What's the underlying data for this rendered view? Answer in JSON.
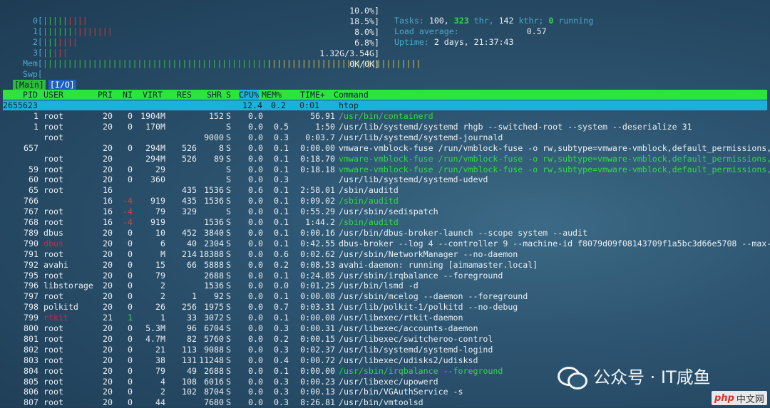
{
  "meters": {
    "cpus": [
      {
        "label": "0[",
        "bar_green": "|||||",
        "bar_red": "||||",
        "value": "10.0%]"
      },
      {
        "label": "1[",
        "bar_green": "||||||",
        "bar_red": "||||||||",
        "value": "18.5%]"
      },
      {
        "label": "2[",
        "bar_green": "|||",
        "bar_red": "||||",
        "value": "8.0%]"
      },
      {
        "label": "3[",
        "bar_green": "||",
        "bar_red": "|||",
        "value": "6.8%]"
      }
    ],
    "mem": {
      "label": "Mem[",
      "bar_green": "|||||||||||||||||||||||||||||||||||||||||||||",
      "bar_yellow": "|||||||||||||||||||||||||||||||",
      "value": "1.32G/3.54G]"
    },
    "swp": {
      "label": "Swp[",
      "value": "0K/0K]"
    }
  },
  "info": {
    "tasks_label": "Tasks:",
    "tasks_value": " 100,",
    "thr_value": " 323",
    "thr_label": " thr,",
    "kthr_value": " 142",
    "kthr_label": " kthr;",
    "running_value": " 0",
    "running_label": " running",
    "load_label": "Load average:",
    "load_value": "0.57",
    "uptime_label": "Uptime:",
    "uptime_value": " 2 days, 21:37:43"
  },
  "tabs": {
    "main": "[Main]",
    "io": "[I/O]"
  },
  "columns": {
    "pid": "PID",
    "user": "USER",
    "pri": "PRI",
    "ni": "NI",
    "virt": "VIRT",
    "res": "RES",
    "shr": "SHR",
    "s": "S",
    "cpu": "CPU%",
    "mem": "MEM%",
    "time": "TIME+",
    "command": "Command"
  },
  "selected": {
    "pid": "2655623",
    "cpu": "12.4",
    "mem": "0.2",
    "time": "0:01",
    "command": "htop"
  },
  "rows": [
    {
      "pid": "1",
      "user": "root",
      "pri": "20",
      "ni": "0",
      "virt": "1904M",
      "res": "",
      "shr": "152",
      "s": "S",
      "cpu": "0.0",
      "mem": "",
      "time": "56.91",
      "command": "/usr/bin/containerd",
      "cmd_color": "green"
    },
    {
      "pid": "1",
      "user": "root",
      "pri": "20",
      "ni": "0",
      "virt": "170M",
      "res": "",
      "shr": "",
      "s": "S",
      "cpu": "0.0",
      "mem": "0.5",
      "time": "1:50",
      "command": "/usr/lib/systemd/systemd rhgb --switched-root --system --deserialize 31",
      "cmd_color": "white"
    },
    {
      "pid": "",
      "user": "root",
      "pri": "",
      "ni": "",
      "virt": "",
      "res": "",
      "shr": "9000",
      "s": "S",
      "cpu": "0.0",
      "mem": "0.3",
      "time": "0:03.7",
      "command": "/usr/lib/systemd/systemd-journald",
      "cmd_color": "white"
    },
    {
      "pid": "657",
      "user": "",
      "pri": "20",
      "ni": "0",
      "virt": "294M",
      "res": "526",
      "shr": "8",
      "s": "S",
      "cpu": "0.0",
      "mem": "0.1",
      "time": "0:00.00",
      "command": "vmware-vmblock-fuse /run/vmblock-fuse -o rw,subtype=vmware-vmblock,default_permissions,",
      "cmd_color": "white"
    },
    {
      "pid": "",
      "user": "root",
      "pri": "20",
      "ni": "",
      "virt": "294M",
      "res": "526",
      "shr": "89",
      "s": "S",
      "cpu": "0.0",
      "mem": "0.1",
      "time": "0:18.70",
      "command": "vmware-vmblock-fuse /run/vmblock-fuse -o rw,subtype=vmware-vmblock,default_permissions,",
      "cmd_color": "green"
    },
    {
      "pid": "59",
      "user": "root",
      "pri": "20",
      "ni": "0",
      "virt": "29",
      "res": "",
      "shr": "",
      "s": "S",
      "cpu": "0.0",
      "mem": "0.1",
      "time": "0:18.18",
      "command": "vmware-vmblock-fuse /run/vmblock-fuse -o rw,subtype=vmware-vmblock,default_permissions,",
      "cmd_color": "green"
    },
    {
      "pid": "60",
      "user": "root",
      "pri": "20",
      "ni": "0",
      "virt": "360",
      "res": "",
      "shr": "",
      "s": "S",
      "cpu": "0.0",
      "mem": "0.3",
      "time": "",
      "command": "/usr/lib/systemd/systemd-udevd",
      "cmd_color": "white"
    },
    {
      "pid": "65",
      "user": "root",
      "pri": "16",
      "ni": "",
      "virt": "",
      "res": "435",
      "shr": "1536",
      "s": "S",
      "cpu": "0.6",
      "mem": "0.1",
      "time": "2:58.01",
      "command": "/sbin/auditd",
      "cmd_color": "white"
    },
    {
      "pid": "766",
      "user": "",
      "pri": "16",
      "ni": "-4",
      "virt": "919",
      "res": "435",
      "shr": "1536",
      "s": "S",
      "cpu": "0.0",
      "mem": "0.1",
      "time": "0:09.02",
      "command": "/sbin/auditd",
      "cmd_color": "green",
      "ni_color": "red"
    },
    {
      "pid": "767",
      "user": "root",
      "pri": "16",
      "ni": "-4",
      "virt": "79",
      "res": "329",
      "shr": "",
      "s": "S",
      "cpu": "0.0",
      "mem": "0.1",
      "time": "0:55.29",
      "command": "/usr/sbin/sedispatch",
      "cmd_color": "white",
      "ni_color": "red"
    },
    {
      "pid": "768",
      "user": "root",
      "pri": "16",
      "ni": "-4",
      "virt": "919",
      "res": "",
      "shr": "1536",
      "s": "S",
      "cpu": "0.0",
      "mem": "0.1",
      "time": "1:44.2",
      "command": "/sbin/auditd",
      "cmd_color": "green",
      "ni_color": "red"
    },
    {
      "pid": "789",
      "user": "dbus",
      "pri": "20",
      "ni": "0",
      "virt": "10",
      "res": "452",
      "shr": "3840",
      "s": "S",
      "cpu": "0.0",
      "mem": "0.1",
      "time": "0:00.16",
      "command": "/usr/bin/dbus-broker-launch --scope system --audit",
      "cmd_color": "white"
    },
    {
      "pid": "790",
      "user": "dbus",
      "pri": "20",
      "ni": "0",
      "virt": "6",
      "res": "40",
      "shr": "2304",
      "s": "S",
      "cpu": "0.0",
      "mem": "0.1",
      "time": "0:42.55",
      "command": "dbus-broker --log 4 --controller 9 --machine-id f8079d09f08143709f1a5bc3d66e5708 --max-",
      "cmd_color": "white",
      "user_color": "maroon"
    },
    {
      "pid": "791",
      "user": "root",
      "pri": "20",
      "ni": "0",
      "virt": "M",
      "res": "214",
      "shr": "18388",
      "s": "S",
      "cpu": "0.0",
      "mem": "0.6",
      "time": "0:02.62",
      "command": "/usr/sbin/NetworkManager --no-daemon",
      "cmd_color": "white"
    },
    {
      "pid": "792",
      "user": "avahi",
      "pri": "20",
      "ni": "0",
      "virt": "15",
      "res": "66",
      "shr": "5888",
      "s": "S",
      "cpu": "0.0",
      "mem": "0.2",
      "time": "0:08.53",
      "command": "avahi-daemon: running [aimamaster.local]",
      "cmd_color": "white"
    },
    {
      "pid": "795",
      "user": "root",
      "pri": "20",
      "ni": "0",
      "virt": "79",
      "res": "",
      "shr": "2688",
      "s": "S",
      "cpu": "0.0",
      "mem": "0.1",
      "time": "0:24.85",
      "command": "/usr/sbin/irqbalance --foreground",
      "cmd_color": "white"
    },
    {
      "pid": "796",
      "user": "libstorage",
      "pri": "20",
      "ni": "0",
      "virt": "2",
      "res": "",
      "shr": "1536",
      "s": "S",
      "cpu": "0.0",
      "mem": "0.0",
      "time": "0:01.25",
      "command": "/usr/bin/lsmd -d",
      "cmd_color": "white"
    },
    {
      "pid": "797",
      "user": "root",
      "pri": "20",
      "ni": "0",
      "virt": "2",
      "res": "1",
      "shr": "92",
      "s": "S",
      "cpu": "0.0",
      "mem": "0.1",
      "time": "0:00.08",
      "command": "/usr/sbin/mcelog --daemon --foreground",
      "cmd_color": "white"
    },
    {
      "pid": "798",
      "user": "polkitd",
      "pri": "20",
      "ni": "0",
      "virt": "26",
      "res": "256",
      "shr": "1975",
      "s": "S",
      "cpu": "0.0",
      "mem": "0.7",
      "time": "0:03.31",
      "command": "/usr/lib/polkit-1/polkitd --no-debug",
      "cmd_color": "white"
    },
    {
      "pid": "799",
      "user": "rtkit",
      "pri": "21",
      "ni": "1",
      "virt": "1",
      "res": "33",
      "shr": "3072",
      "s": "S",
      "cpu": "0.0",
      "mem": "0.1",
      "time": "0:00.08",
      "command": "/usr/libexec/rtkit-daemon",
      "cmd_color": "white",
      "ni_color": "green",
      "user_color": "maroon"
    },
    {
      "pid": "800",
      "user": "root",
      "pri": "20",
      "ni": "0",
      "virt": "5.3M",
      "res": "96",
      "shr": "6704",
      "s": "S",
      "cpu": "0.0",
      "mem": "0.3",
      "time": "0:00.31",
      "command": "/usr/libexec/accounts-daemon",
      "cmd_color": "white"
    },
    {
      "pid": "801",
      "user": "root",
      "pri": "20",
      "ni": "0",
      "virt": "4.7M",
      "res": "82",
      "shr": "5760",
      "s": "S",
      "cpu": "0.0",
      "mem": "0.2",
      "time": "0:00.15",
      "command": "/usr/libexec/switcheroo-control",
      "cmd_color": "white"
    },
    {
      "pid": "802",
      "user": "root",
      "pri": "20",
      "ni": "0",
      "virt": "21",
      "res": "113",
      "shr": "9088",
      "s": "S",
      "cpu": "0.0",
      "mem": "0.3",
      "time": "0:02.37",
      "command": "/usr/lib/systemd/systemd-logind",
      "cmd_color": "white"
    },
    {
      "pid": "803",
      "user": "root",
      "pri": "20",
      "ni": "0",
      "virt": "38",
      "res": "131",
      "shr": "11248",
      "s": "S",
      "cpu": "0.0",
      "mem": "0.4",
      "time": "0:00.72",
      "command": "/usr/libexec/udisks2/udisksd",
      "cmd_color": "white"
    },
    {
      "pid": "804",
      "user": "root",
      "pri": "20",
      "ni": "0",
      "virt": "79",
      "res": "49",
      "shr": "2688",
      "s": "S",
      "cpu": "0.0",
      "mem": "0.1",
      "time": "0:00.00",
      "command": "/usr/sbin/irqbalance --foreground",
      "cmd_color": "green"
    },
    {
      "pid": "805",
      "user": "root",
      "pri": "20",
      "ni": "0",
      "virt": "4",
      "res": "108",
      "shr": "6016",
      "s": "S",
      "cpu": "0.0",
      "mem": "0.3",
      "time": "0:00.23",
      "command": "/usr/libexec/upowerd",
      "cmd_color": "white"
    },
    {
      "pid": "806",
      "user": "root",
      "pri": "20",
      "ni": "0",
      "virt": "2",
      "res": "102",
      "shr": "8704",
      "s": "S",
      "cpu": "0.0",
      "mem": "0.3",
      "time": "0:00.13",
      "command": "/usr/bin/VGAuthService -s",
      "cmd_color": "white"
    },
    {
      "pid": "807",
      "user": "root",
      "pri": "20",
      "ni": "0",
      "virt": "44",
      "res": "",
      "shr": "7680",
      "s": "S",
      "cpu": "0.0",
      "mem": "0.3",
      "time": "8:26.81",
      "command": "/usr/bin/vmtoolsd",
      "cmd_color": "white"
    }
  ],
  "watermark": {
    "text": "公众号 · IT咸鱼",
    "icon": "wechat-icon"
  },
  "badge": {
    "php": "php",
    "text": "中文网"
  }
}
